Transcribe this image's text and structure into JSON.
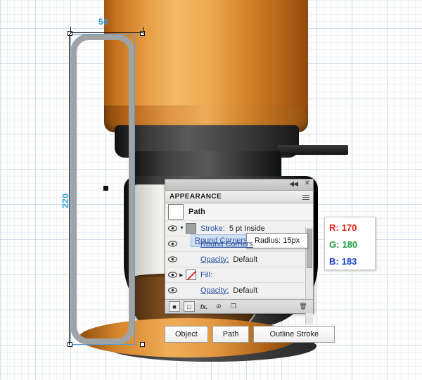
{
  "app": {
    "panel_tab_label": "APPEARANCE",
    "panel_object_label": "Path",
    "collapse_arrows": "◀◀",
    "close_glyph": "✕"
  },
  "measurements": {
    "width_label": "50",
    "height_label": "220"
  },
  "color_readout": {
    "r_key": "R:",
    "r_value": "170",
    "g_key": "G:",
    "g_value": "180",
    "b_key": "B:",
    "b_value": "183",
    "r_color": "#e2231a",
    "g_color": "#1e9e3e",
    "b_color": "#1a42c8"
  },
  "appearance_rows": [
    {
      "name": "Stroke:",
      "value": "5 pt  Inside",
      "swatch": "grey",
      "has_triangle": true
    },
    {
      "name": "Round Corners",
      "value": "",
      "swatch": "none",
      "link": true
    },
    {
      "name": "Opacity:",
      "value": "Default",
      "swatch": "none",
      "link": true
    },
    {
      "name": "Fill:",
      "value": "",
      "swatch": "nofill",
      "has_triangle": true
    },
    {
      "name": "Opacity:",
      "value": "Default",
      "swatch": "none",
      "link": true
    }
  ],
  "tooltip": {
    "radius_label": "Radius: 15px"
  },
  "footer_icons": [
    "new-art-has-basic-appearance-icon",
    "add-new-stroke-icon",
    "add-new-fill-icon",
    "add-new-effect-icon",
    "clear-appearance-icon",
    "duplicate-item-icon",
    "delete-item-icon"
  ],
  "control_bar": {
    "buttons": [
      {
        "label": "Object"
      },
      {
        "label": "Path"
      },
      {
        "label": "Outline Stroke"
      }
    ]
  }
}
